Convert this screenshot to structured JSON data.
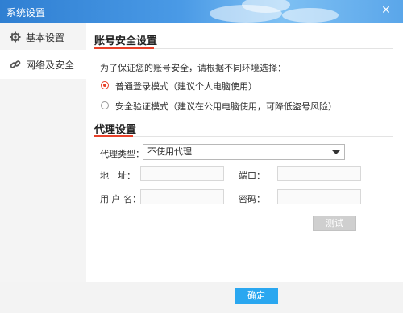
{
  "window": {
    "title": "系统设置",
    "close_icon": "close-icon"
  },
  "sidebar": {
    "items": [
      {
        "label": "基本设置",
        "icon": "gear-icon",
        "active": true
      },
      {
        "label": "网络及安全",
        "icon": "link-icon",
        "active": false
      }
    ]
  },
  "account_security": {
    "title": "账号安全设置",
    "description": "为了保证您的账号安全，请根据不同环境选择：",
    "options": [
      {
        "label": "普通登录模式（建议个人电脑使用）",
        "checked": true
      },
      {
        "label": "安全验证模式（建议在公用电脑使用，可降低盗号风险）",
        "checked": false
      }
    ]
  },
  "proxy": {
    "title": "代理设置",
    "type_label": "代理类型：",
    "type_value": "不使用代理",
    "address_label": "地　址：",
    "port_label": "端口：",
    "username_label": "用 户 名：",
    "password_label": "密码：",
    "test_label": "测试"
  },
  "footer": {
    "ok_label": "确定"
  },
  "colors": {
    "accent": "#e8412a",
    "primary_button": "#2aa7f0",
    "titlebar": "#3a8ddc"
  }
}
